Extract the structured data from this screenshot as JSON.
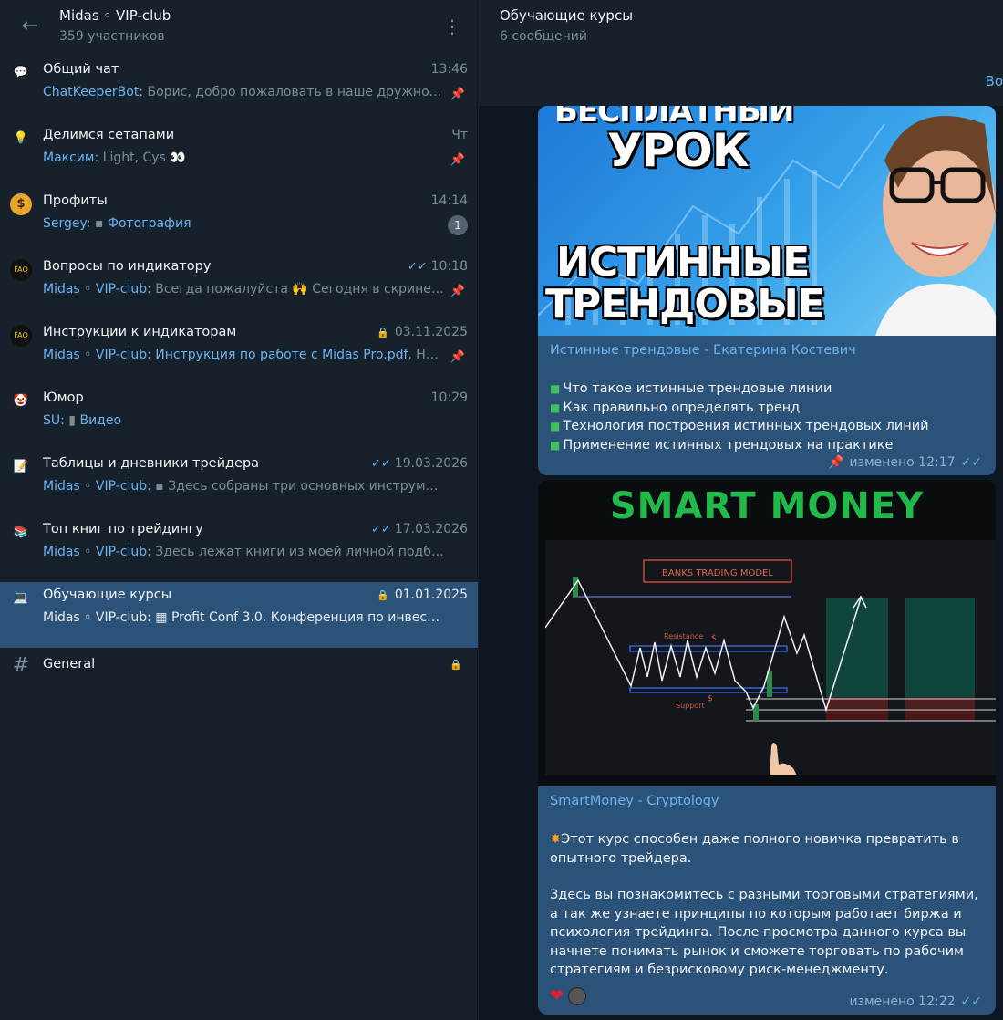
{
  "left": {
    "title": "Midas ◦ VIP-club",
    "subtitle": "359 участников",
    "topics": [
      {
        "icon": "speech-bubble",
        "icon_glyph": "💬",
        "icon_color": "#f5c518",
        "name": "Общий чат",
        "time": "13:46",
        "sender": "ChatKeeperBot:",
        "text": " Борис, добро пожаловать в наше дружно...",
        "pinned": true
      },
      {
        "icon": "lamp",
        "icon_glyph": "💡",
        "icon_color": "#f5c518",
        "name": "Делимся сетапами",
        "time": "Чт",
        "sender": "Максим:",
        "text": " Light, Cys 👀",
        "pinned": true
      },
      {
        "icon": "dollar",
        "icon_glyph": "$",
        "icon_color": "#e8a52a",
        "name": "Профиты",
        "time": "14:14",
        "sender": "Sergey:",
        "text": " ▪ ",
        "media": "Фотография",
        "badge": "1"
      },
      {
        "icon": "faq",
        "icon_glyph": "FAQ",
        "icon_color": "#222",
        "name": "Вопросы по индикатору",
        "time": "10:18",
        "sender": "Midas ◦ VIP-club:",
        "text": " Всегда пожалуйста 🙌 Сегодня в скринер...",
        "pinned": true,
        "checked": true
      },
      {
        "icon": "faq",
        "icon_glyph": "FAQ",
        "icon_color": "#222",
        "name": "Инструкции к индикаторам",
        "time": "03.11.2025",
        "sender": "Midas ◦ VIP-club:",
        "text": " ",
        "media": "Инструкция по работе с Midas Pro.pdf",
        "text2": ", На...",
        "pinned": true,
        "locked": true
      },
      {
        "icon": "clown",
        "icon_glyph": "🤡",
        "icon_color": "#3aa04a",
        "name": "Юмор",
        "time": "10:29",
        "sender": "SU:",
        "text": " ▮ ",
        "media": "Видео"
      },
      {
        "icon": "memo",
        "icon_glyph": "📝",
        "icon_color": "#ddd",
        "name": "Таблицы и дневники трейдера",
        "time": "19.03.2026",
        "sender": "Midas ◦ VIP-club:",
        "text": " ▪ Здесь собраны три основных инструмент...",
        "checked": true
      },
      {
        "icon": "books",
        "icon_glyph": "📚",
        "icon_color": "#c94",
        "name": "Топ книг по трейдингу",
        "time": "17.03.2026",
        "sender": "Midas ◦ VIP-club:",
        "text": " Здесь лежат книги из моей личной подборки ...",
        "checked": true
      },
      {
        "icon": "computer",
        "icon_glyph": "💻",
        "icon_color": "#bbb",
        "name": "Обучающие курсы",
        "time": "01.01.2025",
        "sender": "Midas ◦ VIP-club:",
        "text": " ▦ Profit Conf 3.0. Конференция по инвестиц...",
        "active": true,
        "locked": true
      },
      {
        "icon": "hash",
        "icon_glyph": "#",
        "icon_color": "#7d8b99",
        "name": "General",
        "time": "",
        "sender": "",
        "text": "",
        "locked": true
      }
    ]
  },
  "right": {
    "title": "Обучающие курсы",
    "subtitle": "6 сообщений",
    "cut_link": "Во",
    "messages": [
      {
        "banner_texts": [
          "БЕСПЛАТНЫЙ",
          "УРОК",
          "ИСТИННЫЕ",
          "ТРЕНДОВЫЕ"
        ],
        "link_title": "Истинные трендовые - Екатерина Костевич",
        "bullets": [
          "Что такое истинные трендовые линии",
          "Как правильно определять тренд",
          "Технология построения истинных трендовых линий",
          "Применение истинных трендовых на практике"
        ],
        "meta": "изменено 12:17",
        "pinned": true
      },
      {
        "banner_title": "SMART MONEY",
        "chart_label_box": "BANKS TRADING MODEL",
        "chart_resistance": "Resistance",
        "chart_support": "Support",
        "chart_dollar": "$",
        "link_title": "SmartMoney - Cryptology",
        "para1": "Этот курс способен даже полного новичка превратить в опытного трейдера.",
        "para2": "Здесь вы познакомитесь с разными торговыми стратегиями, а так же узнаете принципы по которым работает биржа и психология трейдинга. После просмотра данного курса вы начнете понимать рынок и сможете торговать по рабочим стратегиям и безрисковому риск-менеджменту.",
        "meta": "изменено 12:22",
        "reactions": [
          "heart",
          "avatar"
        ]
      }
    ]
  }
}
